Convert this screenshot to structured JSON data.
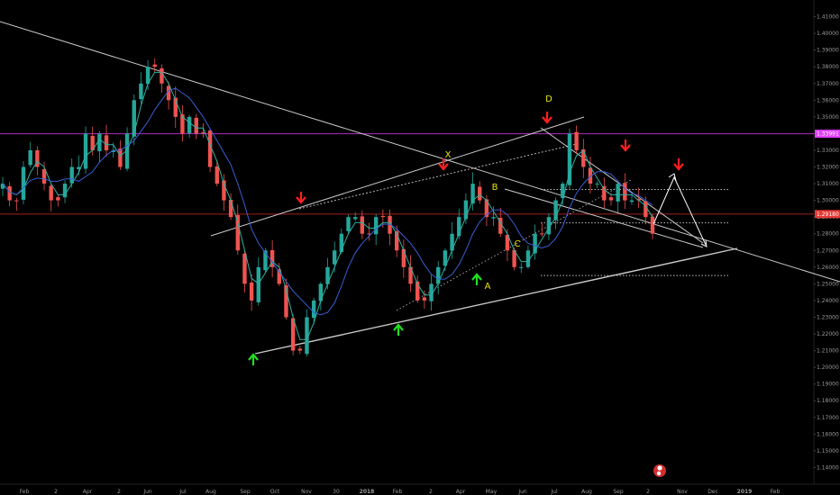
{
  "chart_data": {
    "type": "candlestick",
    "title": "",
    "xlabel": "",
    "ylabel": "",
    "ylim": [
      1.13,
      1.42
    ],
    "y_ticks": [
      "1.41000",
      "1.40000",
      "1.39000",
      "1.38000",
      "1.37000",
      "1.36000",
      "1.35000",
      "1.34000",
      "1.33000",
      "1.32000",
      "1.31000",
      "1.30000",
      "1.29000",
      "1.28000",
      "1.27000",
      "1.26000",
      "1.25000",
      "1.24000",
      "1.23000",
      "1.22000",
      "1.21000",
      "1.20000",
      "1.19000",
      "1.18000",
      "1.17000",
      "1.16000",
      "1.15000",
      "1.14000"
    ],
    "x_ticks": [
      "Feb",
      "2",
      "Apr",
      "2",
      "Jun",
      "Jul",
      "Aug",
      "Sep",
      "Oct",
      "Nov",
      "30",
      "2018",
      "Feb",
      "2",
      "Apr",
      "May",
      "Jun",
      "Jul",
      "Aug",
      "Sep",
      "2",
      "Nov",
      "Dec",
      "2019",
      "Feb"
    ],
    "price_labels": [
      {
        "value": 1.33991,
        "text": "1.33991",
        "color": "#e040fb"
      },
      {
        "value": 1.2918,
        "text": "1.29180",
        "color": "#e53935"
      }
    ],
    "horizontal_levels": [
      {
        "value": 1.33991,
        "color": "#b02cc4",
        "style": "solid"
      },
      {
        "value": 1.2918,
        "color": "#a02020",
        "style": "solid"
      },
      {
        "value": 1.3065,
        "color": "#bbbbbb",
        "style": "dotted"
      },
      {
        "value": 1.2865,
        "color": "#bbbbbb",
        "style": "dotted"
      },
      {
        "value": 1.255,
        "color": "#bbbbbb",
        "style": "dotted"
      }
    ],
    "wave_labels": [
      {
        "text": "D",
        "color": "#e6e600"
      },
      {
        "text": "X",
        "color": "#e6e600"
      },
      {
        "text": "B",
        "color": "#e6e600"
      },
      {
        "text": "C",
        "color": "#e6e600"
      },
      {
        "text": "A",
        "color": "#e6e600"
      }
    ],
    "signals": [
      {
        "type": "down",
        "color": "#ff2020"
      },
      {
        "type": "down",
        "color": "#ff2020"
      },
      {
        "type": "down",
        "color": "#ff2020"
      },
      {
        "type": "down",
        "color": "#ff2020"
      },
      {
        "type": "down",
        "color": "#ff2020"
      },
      {
        "type": "up",
        "color": "#20e020"
      },
      {
        "type": "up",
        "color": "#20e020"
      },
      {
        "type": "up",
        "color": "#20e020"
      }
    ],
    "colors": {
      "background": "#000000",
      "bull": "#26a69a",
      "bear": "#ef5350",
      "ma_fast": "#2bb3a3",
      "ma_slow": "#3a5fd0",
      "trendline": "#c8c8c8",
      "projection": "#ffffff"
    },
    "series": [
      {
        "name": "",
        "values": [
          1.31,
          1.3,
          1.3,
          1.32,
          1.33,
          1.32,
          1.31,
          1.3,
          1.3,
          1.31,
          1.32,
          1.32,
          1.34,
          1.33,
          1.34,
          1.33,
          1.33,
          1.32,
          1.34,
          1.36,
          1.37,
          1.38,
          1.38,
          1.37,
          1.36,
          1.35,
          1.34,
          1.35,
          1.34,
          1.34,
          1.32,
          1.31,
          1.3,
          1.29,
          1.27,
          1.25,
          1.24,
          1.26,
          1.27,
          1.26,
          1.25,
          1.23,
          1.21,
          1.21,
          1.23,
          1.24,
          1.25,
          1.26,
          1.27,
          1.28,
          1.29,
          1.29,
          1.28,
          1.28,
          1.29,
          1.29,
          1.28,
          1.27,
          1.26,
          1.25,
          1.24,
          1.24,
          1.25,
          1.26,
          1.27,
          1.28,
          1.29,
          1.3,
          1.31,
          1.3,
          1.29,
          1.29,
          1.28,
          1.27,
          1.26,
          1.26,
          1.27,
          1.28,
          1.28,
          1.29,
          1.3,
          1.31,
          1.34,
          1.33,
          1.32,
          1.31,
          1.31,
          1.3,
          1.3,
          1.31,
          1.3,
          1.3,
          1.3,
          1.29,
          1.28
        ]
      }
    ]
  }
}
